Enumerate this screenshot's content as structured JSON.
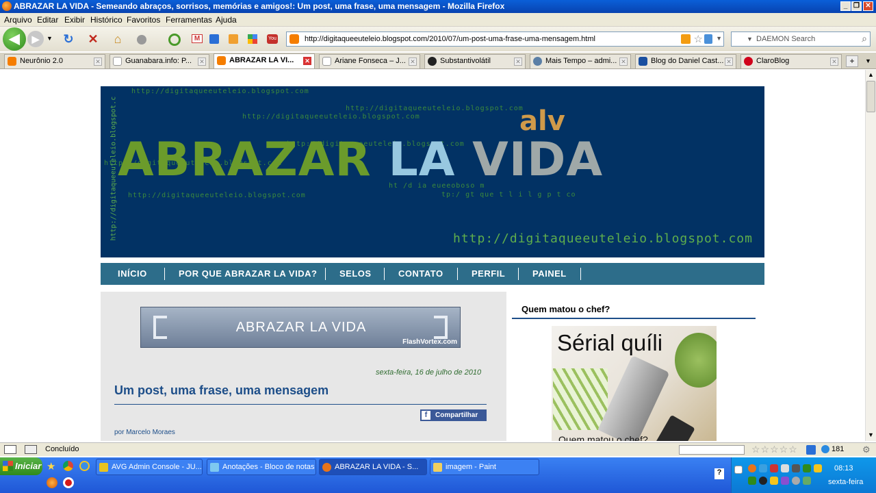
{
  "window": {
    "title": "ABRAZAR LA VIDA - Semeando abraços, sorrisos, memórias e amigos!: Um post, uma frase, uma mensagem - Mozilla Firefox",
    "controls": [
      "_",
      "❐",
      "✕"
    ]
  },
  "menu": [
    "Arquivo",
    "Editar",
    "Exibir",
    "Histórico",
    "Favoritos",
    "Ferramentas",
    "Ajuda"
  ],
  "toolbar": {
    "url": "http://digitaqueeuteleio.blogspot.com/2010/07/um-post-uma-frase-uma-mensagem.html",
    "search_placeholder": "DAEMON Search"
  },
  "tabs": [
    {
      "label": "Neurônio 2.0",
      "color": "#f57d00"
    },
    {
      "label": "Guanabara.info: P...",
      "color": "#ffffff"
    },
    {
      "label": "ABRAZAR LA VI...",
      "color": "#f57d00",
      "active": true
    },
    {
      "label": "Ariane Fonseca – J...",
      "color": "#ffffff"
    },
    {
      "label": "Substantivolátil",
      "color": "#222222"
    },
    {
      "label": "Mais Tempo – admi...",
      "color": "#5b7fa6"
    },
    {
      "label": "Blog do Daniel Cast...",
      "color": "#1a4fa0"
    },
    {
      "label": "ClaroBlog",
      "color": "#d0021b"
    }
  ],
  "banner": {
    "watermark": "http://digitaqueeuteleio.blogspot.com",
    "scrambled_1": "ht /d ia eueeoboso m",
    "scrambled_2": "tp:/ gt que t l i  l g p t co",
    "alv": "alv",
    "title_part1": "ABRAZAR",
    "title_part2": "LA",
    "title_part3": "VIDA",
    "url_big": "http://digitaqueeuteleio.blogspot.com",
    "side_url": "http://digitaqueeuteleio.blogspot.c"
  },
  "nav": [
    "INÍCIO",
    "POR QUE ABRAZAR LA VIDA?",
    "SELOS",
    "CONTATO",
    "PERFIL",
    "PAINEL"
  ],
  "post": {
    "vortex_title": "ABRAZAR LA VIDA",
    "vortex_credit": "FlashVortex.com",
    "date": "sexta-feira, 16 de julho de 2010",
    "title": "Um post, uma frase, uma mensagem",
    "share": "Compartilhar",
    "author": "por Marcelo Moraes"
  },
  "sidebar": {
    "widget_title": "Quem matou o chef?",
    "image_title": "Sérial quíli",
    "image_caption": "Quem matou o chef?"
  },
  "status": {
    "text": "Concluído",
    "count": "181"
  },
  "taskbar": {
    "start": "Iniciar",
    "items": [
      {
        "label": "AVG Admin Console - JU...",
        "color": "#e8c320"
      },
      {
        "label": "Anotações - Bloco de notas",
        "color": "#7ec8f0"
      },
      {
        "label": "ABRAZAR LA VIDA - S...",
        "color": "#e8741a",
        "active": true
      },
      {
        "label": "imagem - Paint",
        "color": "#f0d060"
      }
    ],
    "clock": "08:13",
    "day": "sexta-feira"
  },
  "colors": {
    "banner_bg": "#023264",
    "nav_bg": "#2d6d8a",
    "post_title": "#1d4e89",
    "taskbar": "#245edb"
  }
}
